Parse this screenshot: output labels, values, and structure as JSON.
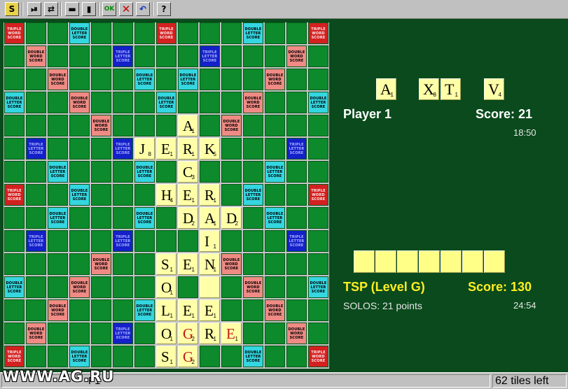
{
  "toolbar": {
    "buttons": [
      {
        "name": "s-logo-button",
        "glyph": "S",
        "cls": "s"
      },
      {
        "name": "play-step-button",
        "glyph": "⏯",
        "cls": ""
      },
      {
        "name": "swap-tiles-button",
        "glyph": "⇄",
        "cls": ""
      },
      {
        "name": "horizontal-direction-button",
        "glyph": "▬",
        "cls": ""
      },
      {
        "name": "vertical-direction-button",
        "glyph": "▮",
        "cls": ""
      },
      {
        "name": "ok-button",
        "glyph": "OK",
        "cls": "ok"
      },
      {
        "name": "cancel-button",
        "glyph": "✕",
        "cls": "x"
      },
      {
        "name": "undo-button",
        "glyph": "↶",
        "cls": "undo"
      },
      {
        "name": "help-button",
        "glyph": "?",
        "cls": ""
      }
    ]
  },
  "premium_labels": {
    "tw": "TRIPLE WORD SCORE",
    "dw": "DOUBLE WORD SCORE",
    "dl": "DOUBLE LETTER SCORE",
    "tl": "TRIPLE LETTER SCORE"
  },
  "board_tiles": [
    {
      "r": 4,
      "c": 8,
      "letter": "A",
      "pts": "1"
    },
    {
      "r": 5,
      "c": 6,
      "letter": "J",
      "pts": "8"
    },
    {
      "r": 5,
      "c": 7,
      "letter": "E",
      "pts": "1"
    },
    {
      "r": 5,
      "c": 8,
      "letter": "R",
      "pts": "1"
    },
    {
      "r": 5,
      "c": 9,
      "letter": "K",
      "pts": "5"
    },
    {
      "r": 6,
      "c": 8,
      "letter": "C",
      "pts": "3"
    },
    {
      "r": 7,
      "c": 7,
      "letter": "H",
      "pts": "4"
    },
    {
      "r": 7,
      "c": 8,
      "letter": "E",
      "pts": "1"
    },
    {
      "r": 7,
      "c": 9,
      "letter": "R",
      "pts": "1"
    },
    {
      "r": 8,
      "c": 8,
      "letter": "D",
      "pts": "2"
    },
    {
      "r": 8,
      "c": 9,
      "letter": "A",
      "pts": "1"
    },
    {
      "r": 8,
      "c": 10,
      "letter": "D",
      "pts": "2"
    },
    {
      "r": 9,
      "c": 9,
      "letter": "I",
      "pts": "1"
    },
    {
      "r": 10,
      "c": 7,
      "letter": "S",
      "pts": "1"
    },
    {
      "r": 10,
      "c": 8,
      "letter": "E",
      "pts": "1"
    },
    {
      "r": 10,
      "c": 9,
      "letter": "N",
      "pts": "1"
    },
    {
      "r": 11,
      "c": 7,
      "letter": "O",
      "pts": "1"
    },
    {
      "r": 11,
      "c": 9,
      "letter": "",
      "pts": ""
    },
    {
      "r": 12,
      "c": 7,
      "letter": "L",
      "pts": "1"
    },
    {
      "r": 12,
      "c": 8,
      "letter": "E",
      "pts": "1"
    },
    {
      "r": 12,
      "c": 9,
      "letter": "E",
      "pts": "1"
    },
    {
      "r": 13,
      "c": 7,
      "letter": "O",
      "pts": "1"
    },
    {
      "r": 13,
      "c": 8,
      "letter": "G",
      "pts": "2",
      "red": true
    },
    {
      "r": 13,
      "c": 9,
      "letter": "R",
      "pts": "1"
    },
    {
      "r": 13,
      "c": 10,
      "letter": "E",
      "pts": "1",
      "red": true
    },
    {
      "r": 14,
      "c": 7,
      "letter": "S",
      "pts": "1"
    },
    {
      "r": 14,
      "c": 8,
      "letter": "G",
      "pts": "2",
      "red": true
    }
  ],
  "rack": [
    {
      "letter": "A",
      "pts": "1"
    },
    {
      "letter": "X",
      "pts": "8"
    },
    {
      "letter": "T",
      "pts": "1"
    },
    {
      "letter": "V",
      "pts": "4"
    }
  ],
  "player1": {
    "name": "Player 1",
    "score": "Score: 21",
    "time": "18:50"
  },
  "player2": {
    "name": "TSP (Level G)",
    "score": "Score: 130",
    "last_play": "SOLOS: 21 points",
    "time": "24:54"
  },
  "status": {
    "left": "F1",
    "tiles_left": "62 tiles left"
  },
  "watermark": "WWW.AG.RU"
}
